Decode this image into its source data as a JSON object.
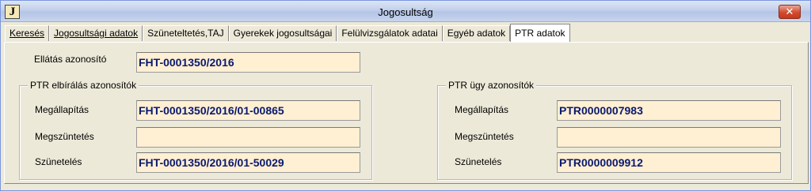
{
  "window": {
    "title": "Jogosultság",
    "app_icon_letter": "J",
    "close_glyph": "✕"
  },
  "tabs": [
    {
      "label": "Keresés",
      "active": false
    },
    {
      "label": "Jogosultsági adatok",
      "active": false
    },
    {
      "label": "Szüneteltetés,TAJ",
      "active": false
    },
    {
      "label": "Gyerekek jogosultságai",
      "active": false
    },
    {
      "label": "Felülvizsgálatok adatai",
      "active": false
    },
    {
      "label": "Egyéb adatok",
      "active": false
    },
    {
      "label": "PTR adatok",
      "active": true
    }
  ],
  "ellatas": {
    "label": "Ellátás azonosító",
    "value": "FHT-0001350/2016"
  },
  "ptr_elbiralas": {
    "title": "PTR elbírálás azonosítók",
    "megallapitas_label": "Megállapítás",
    "megallapitas_value": "FHT-0001350/2016/01-00865",
    "megszuntetes_label": "Megszüntetés",
    "megszuntetes_value": "",
    "szuneteles_label": "Szünetelés",
    "szuneteles_value": "FHT-0001350/2016/01-50029"
  },
  "ptr_ugy": {
    "title": "PTR ügy azonosítók",
    "megallapitas_label": "Megállapítás",
    "megallapitas_value": "PTR0000007983",
    "megszuntetes_label": "Megszüntetés",
    "megszuntetes_value": "",
    "szuneteles_label": "Szünetelés",
    "szuneteles_value": "PTR0000009912"
  },
  "colors": {
    "field_bg": "#FFEFD3",
    "field_text": "#0A1A6E",
    "window_bg": "#ECE9D8",
    "close_red": "#D24B2E"
  }
}
